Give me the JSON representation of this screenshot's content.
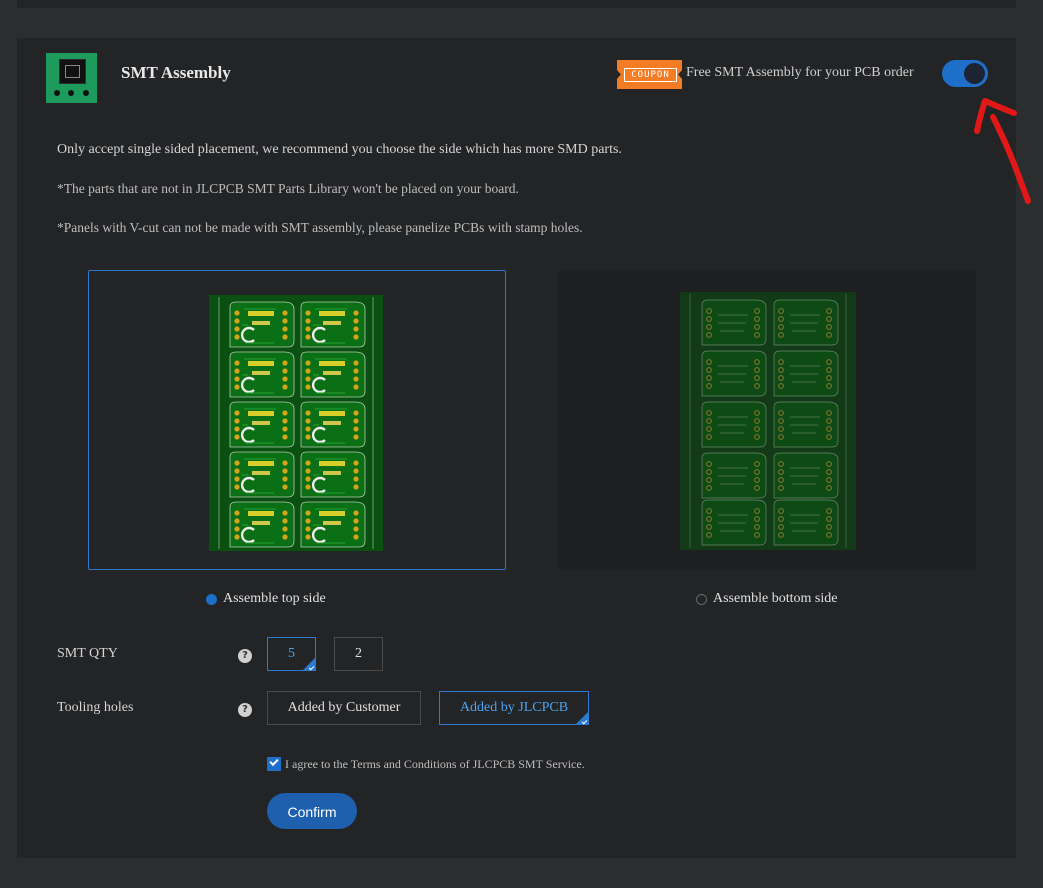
{
  "header": {
    "title": "SMT Assembly",
    "coupon_badge": "COUPON",
    "coupon_text": "Free SMT Assembly for your PCB order",
    "toggle_on": true
  },
  "notes": [
    "Only accept single sided placement, we recommend you choose the side which has more SMD parts.",
    "*The parts that are not in JLCPCB SMT Parts Library won't be placed on your board.",
    "*Panels with V-cut can not be made with SMT assembly, please panelize PCBs with stamp holes."
  ],
  "sides": {
    "top_label": "Assemble top side",
    "bottom_label": "Assemble bottom side",
    "selected": "top"
  },
  "smt_qty": {
    "label": "SMT QTY",
    "options": [
      "5",
      "2"
    ],
    "selected": "5"
  },
  "tooling_holes": {
    "label": "Tooling holes",
    "options": [
      "Added by Customer",
      "Added by JLCPCB"
    ],
    "selected": "Added by JLCPCB"
  },
  "agreement": {
    "text": "I agree to the Terms and Conditions of JLCPCB SMT Service.",
    "checked": true
  },
  "confirm_label": "Confirm",
  "colors": {
    "accent": "#1e6fc9",
    "coupon": "#f47c24",
    "pcb_green": "#0d5e12",
    "annotation": "#e01818"
  }
}
